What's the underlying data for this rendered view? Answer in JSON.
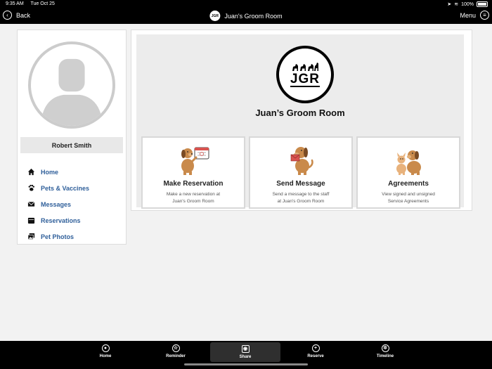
{
  "status_bar": {
    "time": "9:35 AM",
    "date": "Tue Oct 25",
    "battery": "100%"
  },
  "nav": {
    "back_label": "Back",
    "title": "Juan's Groom Room",
    "logo_text": "JGR",
    "menu_label": "Menu"
  },
  "sidebar": {
    "user_name": "Robert Smith",
    "items": [
      {
        "label": "Home",
        "icon": "home-icon"
      },
      {
        "label": "Pets & Vaccines",
        "icon": "paw-icon"
      },
      {
        "label": "Messages",
        "icon": "envelope-icon"
      },
      {
        "label": "Reservations",
        "icon": "calendar-icon"
      },
      {
        "label": "Pet Photos",
        "icon": "photos-icon"
      }
    ]
  },
  "main": {
    "logo_text": "JGR",
    "business_name": "Juan’s Groom Room",
    "cards": [
      {
        "title": "Make Reservation",
        "desc_line1": "Make a new reservation at",
        "desc_line2": "Juan's Groom Room"
      },
      {
        "title": "Send Message",
        "desc_line1": "Send a message to the staff",
        "desc_line2": "at Juan's Groom Room"
      },
      {
        "title": "Agreements",
        "desc_line1": "View signed and unsigned",
        "desc_line2": "Service Agreements"
      }
    ]
  },
  "tabs": [
    {
      "label": "Home",
      "icon": "person-circle-icon"
    },
    {
      "label": "Reminder",
      "icon": "star-circle-icon"
    },
    {
      "label": "Share",
      "icon": "camera-icon",
      "active": true
    },
    {
      "label": "Reserve",
      "icon": "plus-circle-icon"
    },
    {
      "label": "Timeline",
      "icon": "wheel-icon"
    }
  ],
  "colors": {
    "accent_link": "#2f5f9a",
    "bar_bg": "#000000",
    "dog_fur": "#c98a4b"
  }
}
